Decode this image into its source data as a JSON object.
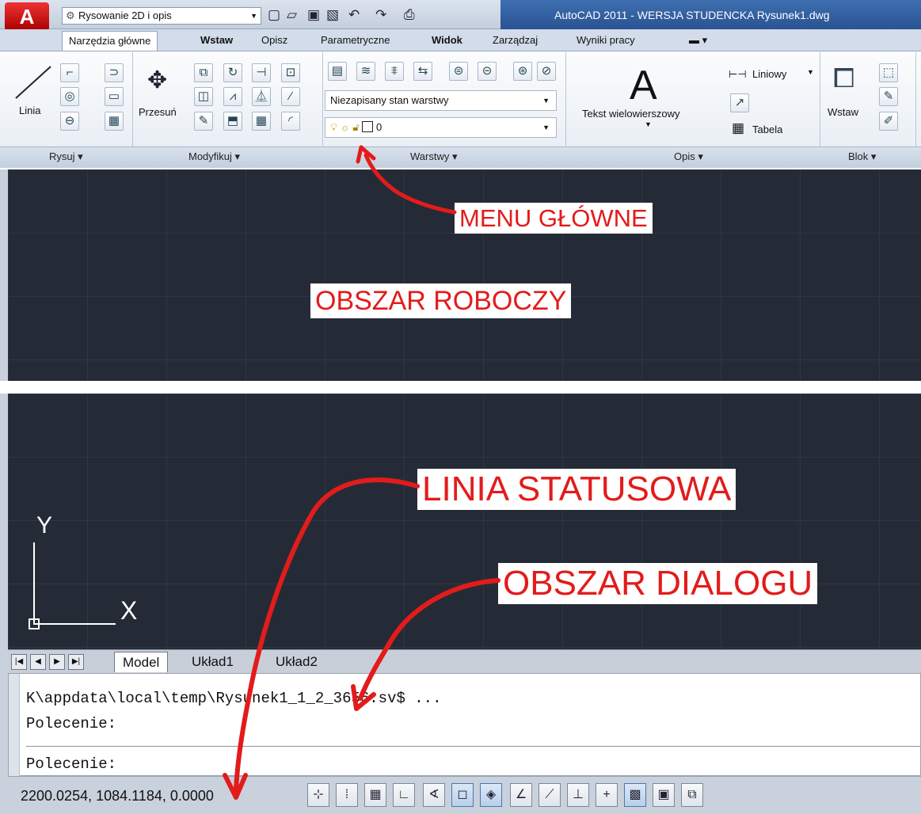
{
  "title_bar": {
    "app_button": "A",
    "workspace": "Rysowanie 2D i opis",
    "title": "AutoCAD 2011 - WERSJA STUDENCKA   Rysunek1.dwg"
  },
  "ribbon_tabs": [
    "Narzędzia główne",
    "Wstaw",
    "Opisz",
    "Parametryczne",
    "Widok",
    "Zarządzaj",
    "Wyniki pracy"
  ],
  "panels": {
    "draw": {
      "title": "Rysuj ▾",
      "line_label": "Linia"
    },
    "modify": {
      "title": "Modyfikuj ▾",
      "move_label": "Przesuń"
    },
    "layers": {
      "title": "Warstwy ▾",
      "state_combo": "Niezapisany stan warstwy",
      "layer_combo": "0"
    },
    "annotation": {
      "title": "Opis ▾",
      "mtext_label": "Tekst wielowierszowy",
      "dim_label": "Liniowy",
      "table_label": "Tabela"
    },
    "block": {
      "title": "Blok ▾",
      "insert_label": "Wstaw"
    }
  },
  "callouts": {
    "main_menu": "MENU GŁÓWNE",
    "work_area": "OBSZAR ROBOCZY",
    "status_line": "LINIA STATUSOWA",
    "dialog_area": "OBSZAR DIALOGU"
  },
  "ucs": {
    "y_label": "Y",
    "x_label": "X"
  },
  "layout_tabs": [
    "Model",
    "Układ1",
    "Układ2"
  ],
  "command": {
    "history_line": "K\\appdata\\local\\temp\\Rysunek1_1_2_3656.sv$ ...",
    "prompt1": "Polecenie:",
    "prompt2": "Polecenie:"
  },
  "status_bar": {
    "coordinates": "2200.0254, 1084.1184, 0.0000"
  },
  "colors": {
    "canvas": "#252b36",
    "callout_text": "#e31b1b",
    "arrow": "#e31b1b"
  }
}
